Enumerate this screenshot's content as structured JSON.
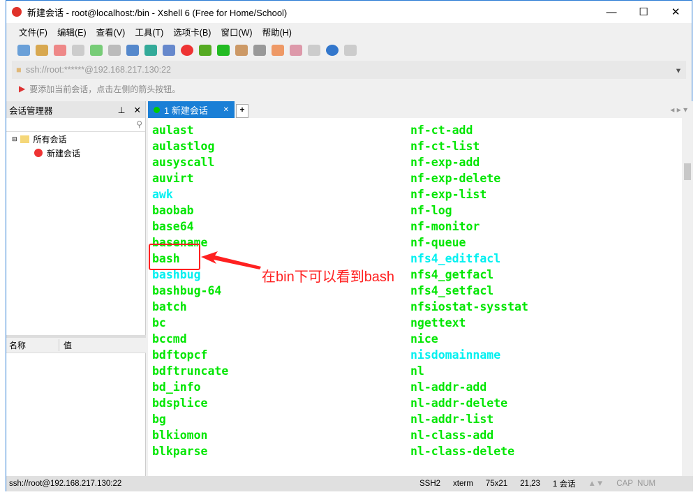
{
  "window": {
    "title": "新建会话 - root@localhost:/bin - Xshell 6 (Free for Home/School)"
  },
  "menu": [
    "文件(F)",
    "编辑(E)",
    "查看(V)",
    "工具(T)",
    "选项卡(B)",
    "窗口(W)",
    "帮助(H)"
  ],
  "address": "ssh://root:******@192.168.217.130:22",
  "hint": "要添加当前会话，点击左侧的箭头按钮。",
  "session_manager": {
    "title": "会话管理器",
    "tree": [
      "所有会话",
      "新建会话"
    ],
    "props_headers": [
      "名称",
      "值"
    ]
  },
  "tab": {
    "label": "1 新建会话"
  },
  "terminal": {
    "col1": [
      {
        "t": "aulast"
      },
      {
        "t": "aulastlog"
      },
      {
        "t": "ausyscall"
      },
      {
        "t": "auvirt"
      },
      {
        "t": "awk",
        "c": 1
      },
      {
        "t": "baobab"
      },
      {
        "t": "base64"
      },
      {
        "t": "basename"
      },
      {
        "t": "bash"
      },
      {
        "t": "bashbug",
        "c": 1
      },
      {
        "t": "bashbug-64"
      },
      {
        "t": "batch"
      },
      {
        "t": "bc"
      },
      {
        "t": "bccmd"
      },
      {
        "t": "bdftopcf"
      },
      {
        "t": "bdftruncate"
      },
      {
        "t": "bd_info"
      },
      {
        "t": "bdsplice"
      },
      {
        "t": "bg"
      },
      {
        "t": "blkiomon"
      },
      {
        "t": "blkparse"
      }
    ],
    "col2": [
      {
        "t": "nf-ct-add"
      },
      {
        "t": "nf-ct-list"
      },
      {
        "t": "nf-exp-add"
      },
      {
        "t": "nf-exp-delete"
      },
      {
        "t": "nf-exp-list"
      },
      {
        "t": "nf-log"
      },
      {
        "t": "nf-monitor"
      },
      {
        "t": "nf-queue"
      },
      {
        "t": "nfs4_editfacl",
        "c": 1
      },
      {
        "t": "nfs4_getfacl"
      },
      {
        "t": "nfs4_setfacl"
      },
      {
        "t": "nfsiostat-sysstat"
      },
      {
        "t": "ngettext"
      },
      {
        "t": "nice"
      },
      {
        "t": "nisdomainname",
        "c": 1
      },
      {
        "t": "nl"
      },
      {
        "t": "nl-addr-add"
      },
      {
        "t": "nl-addr-delete"
      },
      {
        "t": "nl-addr-list"
      },
      {
        "t": "nl-class-add"
      },
      {
        "t": "nl-class-delete"
      }
    ]
  },
  "annotation": "在bin下可以看到bash",
  "status": {
    "left": "ssh://root@192.168.217.130:22",
    "proto": "SSH2",
    "term": "xterm",
    "size": "75x21",
    "pos": "21,23",
    "sessions": "1 会话",
    "cap": "CAP",
    "num": "NUM"
  },
  "colors": {
    "accent": "#1a7fd6",
    "green": "#00e600",
    "cyan": "#00f0f0",
    "annotation": "#ff2020"
  }
}
